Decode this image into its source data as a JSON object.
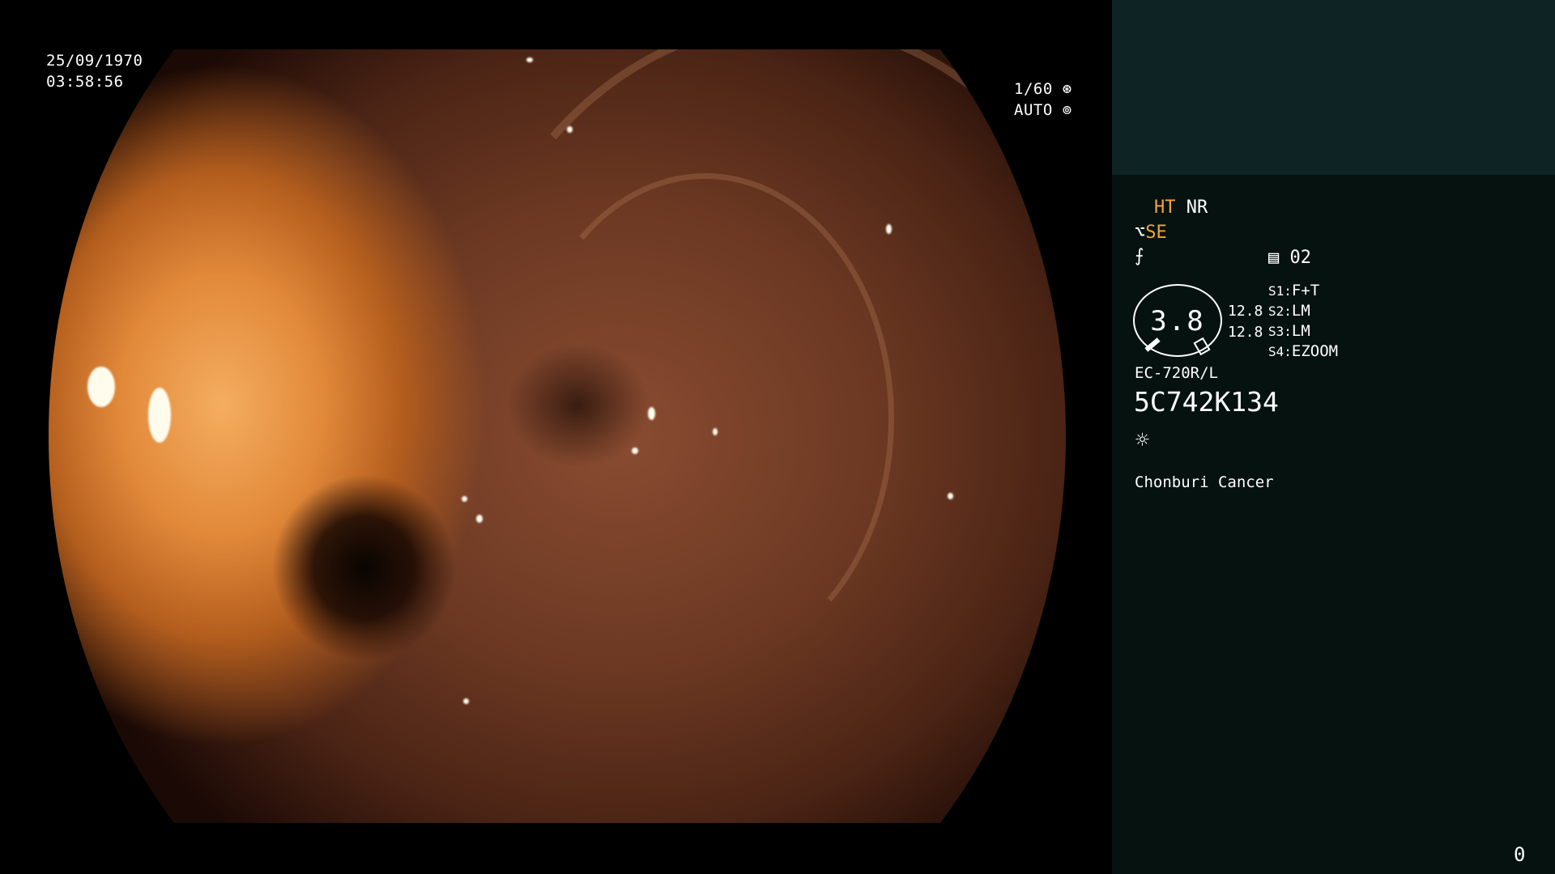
{
  "overlay": {
    "date": "25/09/1970",
    "time": "03:58:56",
    "shutter": "1/60",
    "iris": "AUTO"
  },
  "panel": {
    "mode_ht": "HT",
    "mode_nr": "NR",
    "mode_se": "SE",
    "memory_value": "02",
    "gauge_value": "3.8",
    "value_top": "12.8",
    "value_bottom": "12.8",
    "switches": [
      {
        "key": "S1",
        "value": "F+T"
      },
      {
        "key": "S2",
        "value": "LM"
      },
      {
        "key": "S3",
        "value": "LM"
      },
      {
        "key": "S4",
        "value": "EZOOM"
      }
    ],
    "scope_model": "EC-720R/L",
    "scope_serial": "5C742K134",
    "hospital": "Chonburi Cancer",
    "counter": "0"
  },
  "colors": {
    "accent": "#f2a43b",
    "panel_bg": "#051210",
    "panel_top_bg": "#0e2324"
  },
  "icons": {
    "shutter": "aperture-icon",
    "iris": "iris-icon",
    "structure": "structure-enhance-icon",
    "gamma": "gamma-curve-icon",
    "memory": "memory-card-icon",
    "light": "light-sun-icon"
  }
}
